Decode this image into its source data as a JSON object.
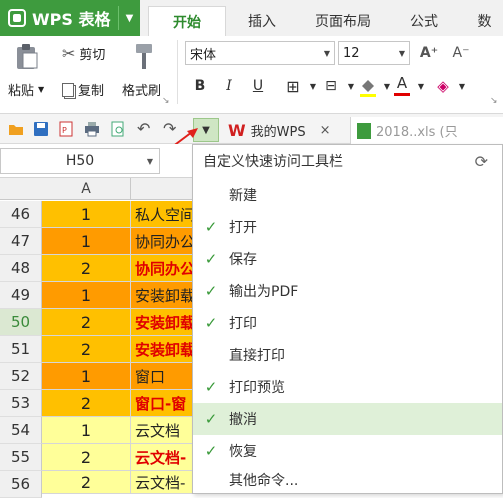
{
  "app": {
    "title": "WPS 表格"
  },
  "ribbon_tabs": [
    "开始",
    "插入",
    "页面布局",
    "公式",
    "数"
  ],
  "ribbon": {
    "paste_label": "粘贴",
    "cut_label": "剪切",
    "copy_label": "复制",
    "format_painter_label": "格式刷",
    "font_name": "宋体",
    "font_size": "12",
    "bold": "B",
    "italic": "I",
    "underline": "U",
    "font_color_glyph": "A"
  },
  "doc_tabs": {
    "my_wps": "我的WPS",
    "close": "×",
    "file_tab": "2018..xls (只"
  },
  "namebox": {
    "value": "H50"
  },
  "columns": {
    "a": "A"
  },
  "rows": [
    {
      "num": "46",
      "a": "1",
      "b": "私人空间"
    },
    {
      "num": "47",
      "a": "1",
      "b": "协同办公"
    },
    {
      "num": "48",
      "a": "2",
      "b": "协同办公"
    },
    {
      "num": "49",
      "a": "1",
      "b": "安装卸载"
    },
    {
      "num": "50",
      "a": "2",
      "b": "安装卸载"
    },
    {
      "num": "51",
      "a": "2",
      "b": "安装卸载"
    },
    {
      "num": "52",
      "a": "1",
      "b": "窗口"
    },
    {
      "num": "53",
      "a": "2",
      "b": "窗口-窗"
    },
    {
      "num": "54",
      "a": "1",
      "b": "云文档"
    },
    {
      "num": "55",
      "a": "2",
      "b": "云文档-"
    },
    {
      "num": "56",
      "a": "2",
      "b": "云文档-"
    }
  ],
  "menu": {
    "title": "自定义快速访问工具栏",
    "items": [
      {
        "label": "新建",
        "checked": ""
      },
      {
        "label": "打开",
        "checked": "✓"
      },
      {
        "label": "保存",
        "checked": "✓"
      },
      {
        "label": "输出为PDF",
        "checked": "✓"
      },
      {
        "label": "打印",
        "checked": "✓"
      },
      {
        "label": "直接打印",
        "checked": ""
      },
      {
        "label": "打印预览",
        "checked": "✓"
      },
      {
        "label": "撤消",
        "checked": "✓"
      },
      {
        "label": "恢复",
        "checked": "✓"
      },
      {
        "label": "其他命令...",
        "checked": ""
      }
    ]
  },
  "colors": {
    "accent_green": "#3e9b3e",
    "yellow": "#ffc000",
    "orange": "#ff9b00",
    "light_yellow": "#ffff99",
    "menu_highlight": "#dff0d8",
    "red_text": "#e00000",
    "arrow_red": "#e0201a"
  }
}
